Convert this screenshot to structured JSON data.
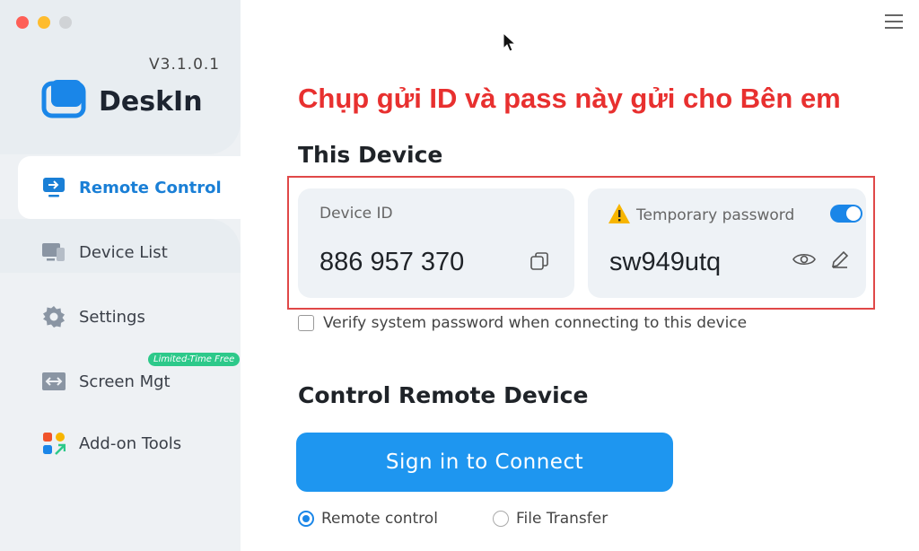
{
  "window": {
    "traffic_lights": {
      "close": "#fe5f57",
      "minimize": "#febc2e",
      "zoom": "#d0d3d6"
    }
  },
  "sidebar": {
    "version": "V3.1.0.1",
    "app_name": "DeskIn",
    "items": [
      {
        "label": "Remote Control",
        "icon": "monitor-arrow-icon",
        "active": true
      },
      {
        "label": "Device List",
        "icon": "devices-icon",
        "active": false
      },
      {
        "label": "Settings",
        "icon": "gear-icon",
        "active": false
      },
      {
        "label": "Screen Mgt",
        "icon": "screen-manage-icon",
        "active": false,
        "badge": "Limited-Time Free"
      },
      {
        "label": "Add-on Tools",
        "icon": "grid-apps-icon",
        "active": false
      }
    ]
  },
  "annotation": "Chụp gửi ID và pass này gửi cho Bên em",
  "this_device": {
    "heading": "This Device",
    "device_id_label": "Device ID",
    "device_id": "886 957 370",
    "password_label": "Temporary password",
    "password": "sw949utq",
    "password_toggle_on": true,
    "verify_label": "Verify system password when connecting to this device",
    "verify_checked": false
  },
  "control": {
    "heading": "Control Remote Device",
    "connect_button": "Sign in to Connect",
    "modes": [
      {
        "label": "Remote control",
        "selected": true
      },
      {
        "label": "File Transfer",
        "selected": false
      }
    ]
  },
  "colors": {
    "accent": "#1e96f0",
    "annotation": "#e8302f",
    "badge": "#2dc98a"
  }
}
